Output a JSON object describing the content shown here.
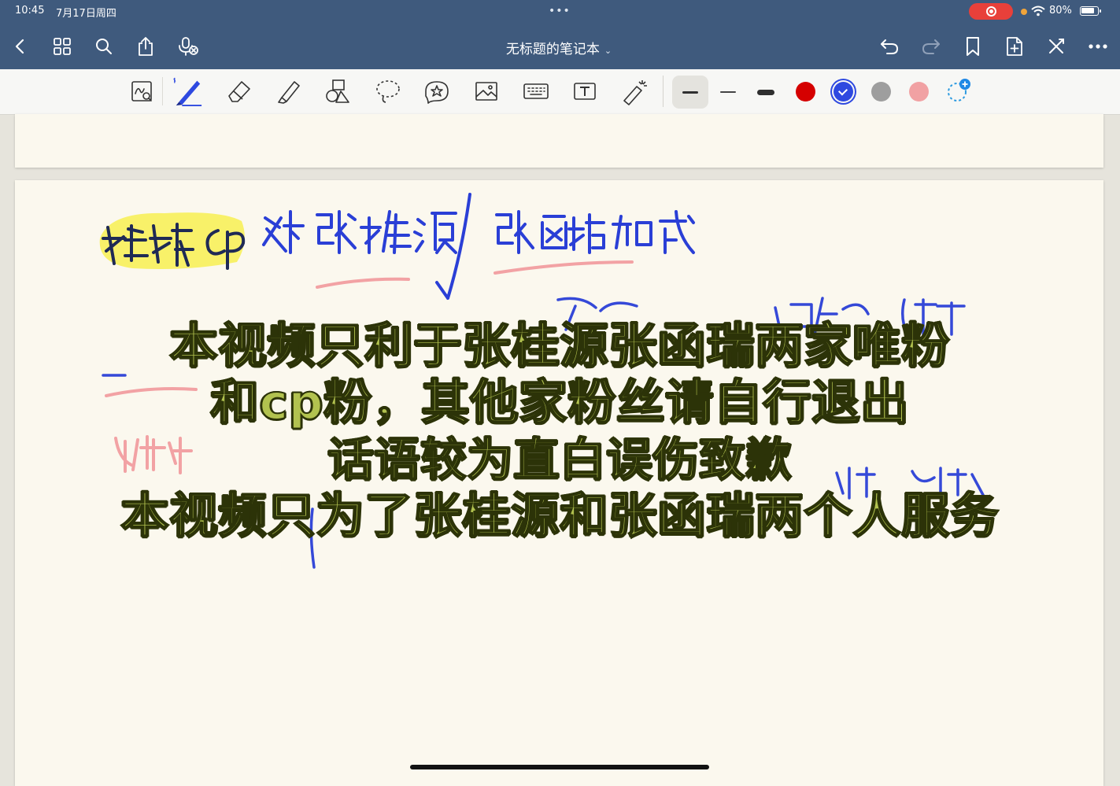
{
  "status_bar": {
    "time": "10:45",
    "date": "7月17日周四",
    "multitask": "•••",
    "battery_percent": "80%",
    "battery_level": 0.8,
    "recording_color": "#e8403a"
  },
  "title_bar": {
    "notebook_title": "无标题的笔记本",
    "background": "#3f5a7d",
    "left_icons": [
      "back-icon",
      "grid-icon",
      "search-icon",
      "share-icon",
      "mic-icon"
    ],
    "right_icons": [
      "undo-icon",
      "redo-icon",
      "bookmark-icon",
      "add-page-icon",
      "close-icon",
      "more-icon"
    ]
  },
  "toolbar": {
    "tools": [
      "read-mode-icon",
      "pen-icon",
      "eraser-icon",
      "highlighter-icon",
      "shapes-icon",
      "lasso-icon",
      "sticker-icon",
      "image-icon",
      "keyboard-icon",
      "text-box-icon",
      "laser-pointer-icon"
    ],
    "stroke_widths": [
      "medium",
      "thin",
      "thick"
    ],
    "selected_stroke": "medium",
    "colors": [
      "#d50000",
      "#2e49e0",
      "#9e9e9e",
      "#f1a1a3"
    ],
    "selected_color": "#2e49e0"
  },
  "handwriting": {
    "yellow_highlight": "#f7ef5a",
    "ink_blue": "#2a3fd6",
    "ink_pink": "#f2a2a4",
    "ink_black": "#1f2a55"
  },
  "caption": {
    "line1": "本视频只利于张桂源张函瑞两家唯粉",
    "line2": "和cp粉，其他家粉丝请自行退出",
    "line3": "话语较为直白误伤致歉",
    "line4": "本视频只为了张桂源和张函瑞两个人服务"
  }
}
